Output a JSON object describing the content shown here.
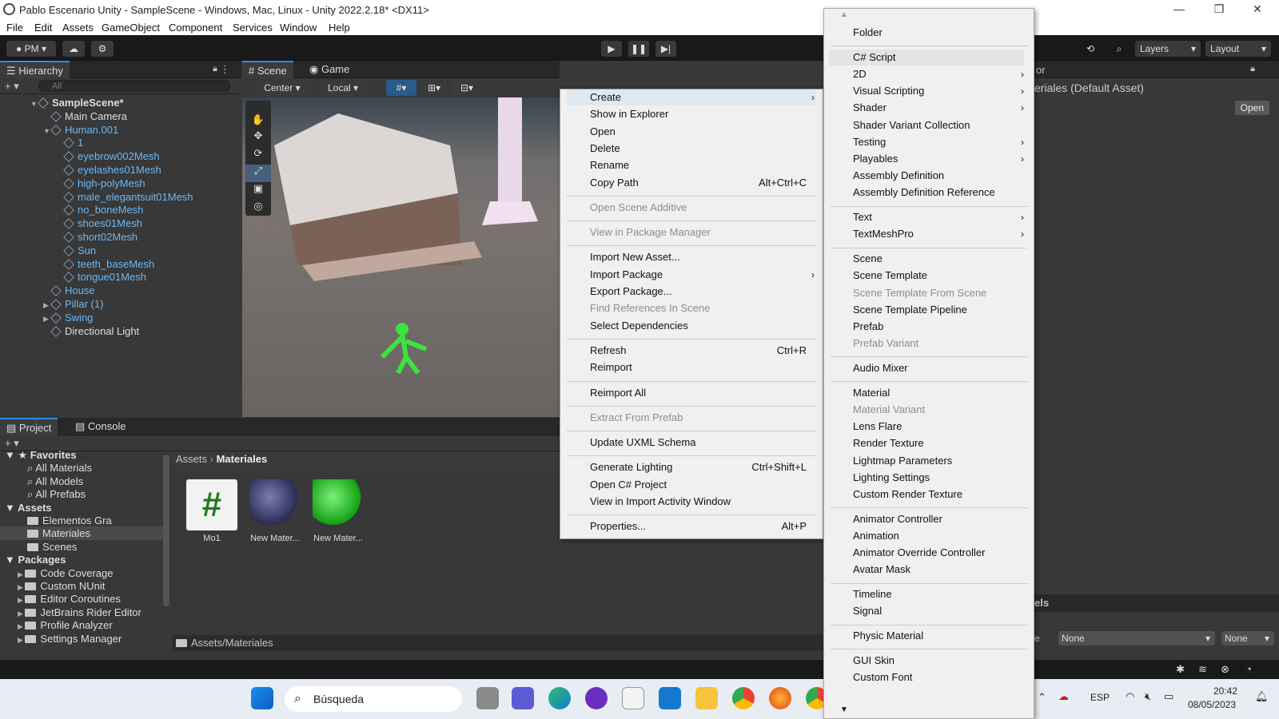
{
  "window": {
    "title": "Pablo Escenario Unity - SampleScene - Windows, Mac, Linux - Unity 2022.2.18* <DX11>"
  },
  "menubar": [
    "File",
    "Edit",
    "Assets",
    "GameObject",
    "Component",
    "Services",
    "Window",
    "Help"
  ],
  "toolbar": {
    "account": "PM",
    "layers": "Layers",
    "layout": "Layout"
  },
  "hierarchy": {
    "tab": "Hierarchy",
    "search_placeholder": "All",
    "rows": [
      {
        "label": "SampleScene*",
        "indent": 0,
        "bold": true,
        "color": "grey",
        "arrow": "▼"
      },
      {
        "label": "Main Camera",
        "indent": 1,
        "color": "grey",
        "arrow": ""
      },
      {
        "label": "Human.001",
        "indent": 1,
        "color": "blue",
        "arrow": "▼"
      },
      {
        "label": "1",
        "indent": 2,
        "color": "blue",
        "arrow": ""
      },
      {
        "label": "eyebrow002Mesh",
        "indent": 2,
        "color": "blue",
        "arrow": ""
      },
      {
        "label": "eyelashes01Mesh",
        "indent": 2,
        "color": "blue",
        "arrow": ""
      },
      {
        "label": "high-polyMesh",
        "indent": 2,
        "color": "blue",
        "arrow": ""
      },
      {
        "label": "male_elegantsuit01Mesh",
        "indent": 2,
        "color": "blue",
        "arrow": ""
      },
      {
        "label": "no_boneMesh",
        "indent": 2,
        "color": "blue",
        "arrow": ""
      },
      {
        "label": "shoes01Mesh",
        "indent": 2,
        "color": "blue",
        "arrow": ""
      },
      {
        "label": "short02Mesh",
        "indent": 2,
        "color": "blue",
        "arrow": ""
      },
      {
        "label": "Sun",
        "indent": 2,
        "color": "blue",
        "arrow": ""
      },
      {
        "label": "teeth_baseMesh",
        "indent": 2,
        "color": "blue",
        "arrow": ""
      },
      {
        "label": "tongue01Mesh",
        "indent": 2,
        "color": "blue",
        "arrow": ""
      },
      {
        "label": "House",
        "indent": 1,
        "color": "blue",
        "arrow": ""
      },
      {
        "label": "Pillar (1)",
        "indent": 1,
        "color": "blue",
        "arrow": "▶"
      },
      {
        "label": "Swing",
        "indent": 1,
        "color": "blue",
        "arrow": "▶"
      },
      {
        "label": "Directional Light",
        "indent": 1,
        "color": "grey",
        "arrow": ""
      }
    ]
  },
  "scene": {
    "tab_scene": "Scene",
    "tab_game": "Game",
    "pivot": "Center",
    "space": "Local"
  },
  "project": {
    "tab_project": "Project",
    "tab_console": "Console",
    "breadcrumb_root": "Assets",
    "breadcrumb_current": "Materiales",
    "footer_path": "Assets/Materiales",
    "tree": [
      {
        "label": "Favorites",
        "indent": 0,
        "header": true
      },
      {
        "label": "All Materials",
        "indent": 1,
        "search": true
      },
      {
        "label": "All Models",
        "indent": 1,
        "search": true
      },
      {
        "label": "All Prefabs",
        "indent": 1,
        "search": true
      },
      {
        "label": "Assets",
        "indent": 0,
        "header": true
      },
      {
        "label": "Elementos Gra",
        "indent": 1
      },
      {
        "label": "Materiales",
        "indent": 1,
        "selected": true
      },
      {
        "label": "Scenes",
        "indent": 1
      },
      {
        "label": "Packages",
        "indent": 0,
        "header": true
      },
      {
        "label": "Code Coverage",
        "indent": 1
      },
      {
        "label": "Custom NUnit",
        "indent": 1
      },
      {
        "label": "Editor Coroutines",
        "indent": 1
      },
      {
        "label": "JetBrains Rider Editor",
        "indent": 1
      },
      {
        "label": "Profile Analyzer",
        "indent": 1
      },
      {
        "label": "Settings Manager",
        "indent": 1
      }
    ],
    "assets": [
      {
        "label": "Mo1",
        "kind": "script"
      },
      {
        "label": "New Mater...",
        "kind": "purple"
      },
      {
        "label": "New Mater...",
        "kind": "green"
      }
    ]
  },
  "inspector": {
    "title_fragment": "eriales (Default Asset)",
    "open_button": "Open",
    "tab_fragment": "or",
    "labels_fragment": "els",
    "none1": "None",
    "none2": "None",
    "e_label": "e"
  },
  "context_menu": [
    {
      "label": "Create",
      "submenu": true,
      "highlight": true
    },
    {
      "label": "Show in Explorer"
    },
    {
      "label": "Open"
    },
    {
      "label": "Delete"
    },
    {
      "label": "Rename"
    },
    {
      "label": "Copy Path",
      "shortcut": "Alt+Ctrl+C"
    },
    {
      "sep": true
    },
    {
      "label": "Open Scene Additive",
      "disabled": true
    },
    {
      "sep": true
    },
    {
      "label": "View in Package Manager",
      "disabled": true
    },
    {
      "sep": true
    },
    {
      "label": "Import New Asset..."
    },
    {
      "label": "Import Package",
      "submenu": true
    },
    {
      "label": "Export Package..."
    },
    {
      "label": "Find References In Scene",
      "disabled": true
    },
    {
      "label": "Select Dependencies"
    },
    {
      "sep": true
    },
    {
      "label": "Refresh",
      "shortcut": "Ctrl+R"
    },
    {
      "label": "Reimport"
    },
    {
      "sep": true
    },
    {
      "label": "Reimport All"
    },
    {
      "sep": true
    },
    {
      "label": "Extract From Prefab",
      "disabled": true
    },
    {
      "sep": true
    },
    {
      "label": "Update UXML Schema"
    },
    {
      "sep": true
    },
    {
      "label": "Generate Lighting",
      "shortcut": "Ctrl+Shift+L"
    },
    {
      "label": "Open C# Project"
    },
    {
      "label": "View in Import Activity Window"
    },
    {
      "sep": true
    },
    {
      "label": "Properties...",
      "shortcut": "Alt+P"
    }
  ],
  "create_submenu": [
    {
      "label": "Folder"
    },
    {
      "sep": true
    },
    {
      "label": "C# Script",
      "highlight": true
    },
    {
      "label": "2D",
      "submenu": true
    },
    {
      "label": "Visual Scripting",
      "submenu": true
    },
    {
      "label": "Shader",
      "submenu": true
    },
    {
      "label": "Shader Variant Collection"
    },
    {
      "label": "Testing",
      "submenu": true
    },
    {
      "label": "Playables",
      "submenu": true
    },
    {
      "label": "Assembly Definition"
    },
    {
      "label": "Assembly Definition Reference"
    },
    {
      "sep": true
    },
    {
      "label": "Text",
      "submenu": true
    },
    {
      "label": "TextMeshPro",
      "submenu": true
    },
    {
      "sep": true
    },
    {
      "label": "Scene"
    },
    {
      "label": "Scene Template"
    },
    {
      "label": "Scene Template From Scene",
      "disabled": true
    },
    {
      "label": "Scene Template Pipeline"
    },
    {
      "label": "Prefab"
    },
    {
      "label": "Prefab Variant",
      "disabled": true
    },
    {
      "sep": true
    },
    {
      "label": "Audio Mixer"
    },
    {
      "sep": true
    },
    {
      "label": "Material"
    },
    {
      "label": "Material Variant",
      "disabled": true
    },
    {
      "label": "Lens Flare"
    },
    {
      "label": "Render Texture"
    },
    {
      "label": "Lightmap Parameters"
    },
    {
      "label": "Lighting Settings"
    },
    {
      "label": "Custom Render Texture"
    },
    {
      "sep": true
    },
    {
      "label": "Animator Controller"
    },
    {
      "label": "Animation"
    },
    {
      "label": "Animator Override Controller"
    },
    {
      "label": "Avatar Mask"
    },
    {
      "sep": true
    },
    {
      "label": "Timeline"
    },
    {
      "label": "Signal"
    },
    {
      "sep": true
    },
    {
      "label": "Physic Material"
    },
    {
      "sep": true
    },
    {
      "label": "GUI Skin"
    },
    {
      "label": "Custom Font"
    }
  ],
  "taskbar": {
    "search": "Búsqueda",
    "lang": "ESP",
    "time": "20:42",
    "date": "08/05/2023"
  }
}
